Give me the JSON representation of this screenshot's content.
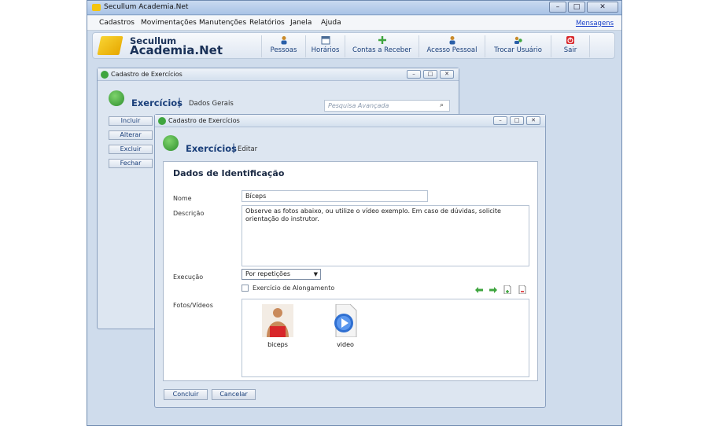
{
  "app": {
    "title": "Secullum Academia.Net",
    "menu": [
      "Cadastros",
      "Movimentações",
      "Manutenções",
      "Relatórios",
      "Janela",
      "Ajuda"
    ],
    "messages_link": "Mensagens",
    "logo": {
      "line1": "Secullum",
      "line2": "Academia.Net"
    },
    "toolbar": [
      {
        "label": "Pessoas",
        "icon": "people-icon"
      },
      {
        "label": "Horários",
        "icon": "calendar-icon"
      },
      {
        "label": "Contas a Receber",
        "icon": "money-icon"
      },
      {
        "label": "Acesso Pessoal",
        "icon": "access-icon"
      },
      {
        "label": "Trocar Usuário",
        "icon": "switch-user-icon"
      },
      {
        "label": "Sair",
        "icon": "exit-icon"
      }
    ]
  },
  "back_window": {
    "title": "Cadastro de Exercícios",
    "heading": "Exercícios",
    "subheading": "Dados Gerais",
    "search_placeholder": "Pesquisa Avançada",
    "buttons": [
      "Incluir",
      "Alterar",
      "Excluir",
      "Fechar"
    ]
  },
  "front_window": {
    "title": "Cadastro de Exercícios",
    "heading": "Exercícios",
    "subheading": "Editar",
    "section_title": "Dados de Identificação",
    "fields": {
      "nome_label": "Nome",
      "nome_value": "Bíceps",
      "descricao_label": "Descrição",
      "descricao_value": "Observe as fotos abaixo, ou utilize o vídeo exemplo. Em caso de dúvidas, solicite orientação do instrutor.",
      "execucao_label": "Execução",
      "execucao_value": "Por repetições",
      "alongamento_label": "Exercício de Alongamento",
      "fotos_label": "Fotos/Vídeos"
    },
    "media": [
      {
        "name": "biceps",
        "icon": "photo-thumbnail-icon"
      },
      {
        "name": "video",
        "icon": "video-file-icon"
      }
    ],
    "buttons": {
      "ok": "Concluir",
      "cancel": "Cancelar"
    }
  },
  "colors": {
    "accent": "#1a3f7a",
    "link": "#1a40c9",
    "logo": "#f4c40f",
    "icon_green": "#3fa53f"
  }
}
